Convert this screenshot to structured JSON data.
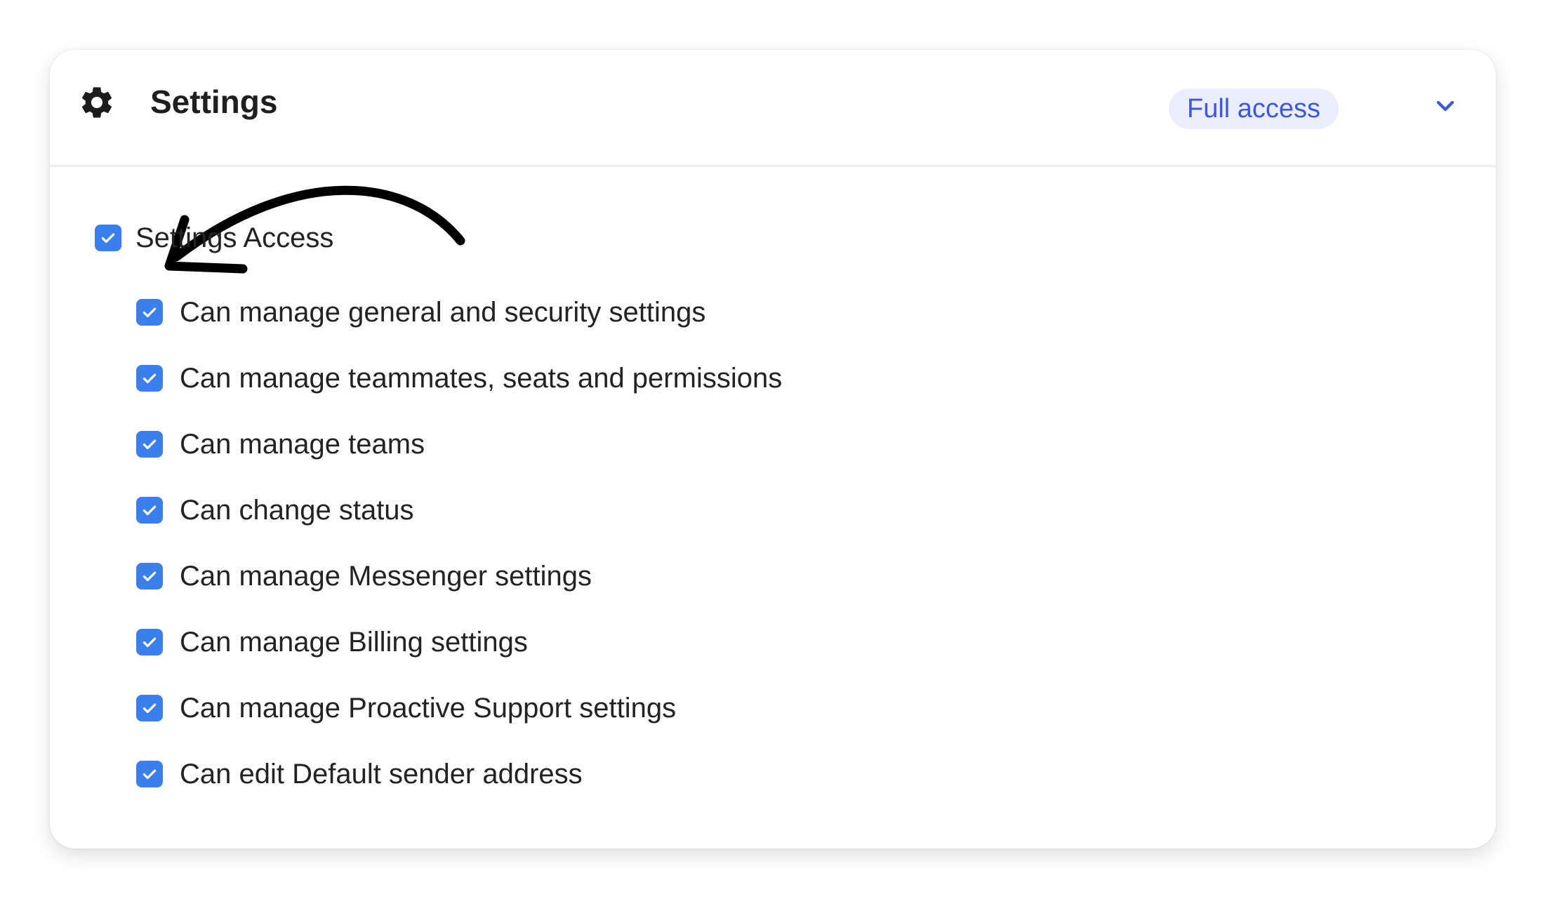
{
  "section": {
    "icon": "gear-icon",
    "title": "Settings",
    "access_badge": "Full access",
    "expand_icon": "chevron-down-icon"
  },
  "parent_permission": {
    "label": "Settings Access",
    "checked": true
  },
  "permissions": [
    {
      "label": "Can manage general and security settings",
      "checked": true
    },
    {
      "label": "Can manage teammates, seats and permissions",
      "checked": true
    },
    {
      "label": "Can manage teams",
      "checked": true
    },
    {
      "label": "Can change status",
      "checked": true
    },
    {
      "label": "Can manage Messenger settings",
      "checked": true
    },
    {
      "label": "Can manage Billing settings",
      "checked": true
    },
    {
      "label": "Can manage Proactive Support settings",
      "checked": true
    },
    {
      "label": "Can edit Default sender address",
      "checked": true
    }
  ],
  "colors": {
    "checkbox": "#3b7fee",
    "badge_background": "#e9edfd",
    "badge_text": "#3d58e0",
    "annotation_arrow": "#000000"
  }
}
